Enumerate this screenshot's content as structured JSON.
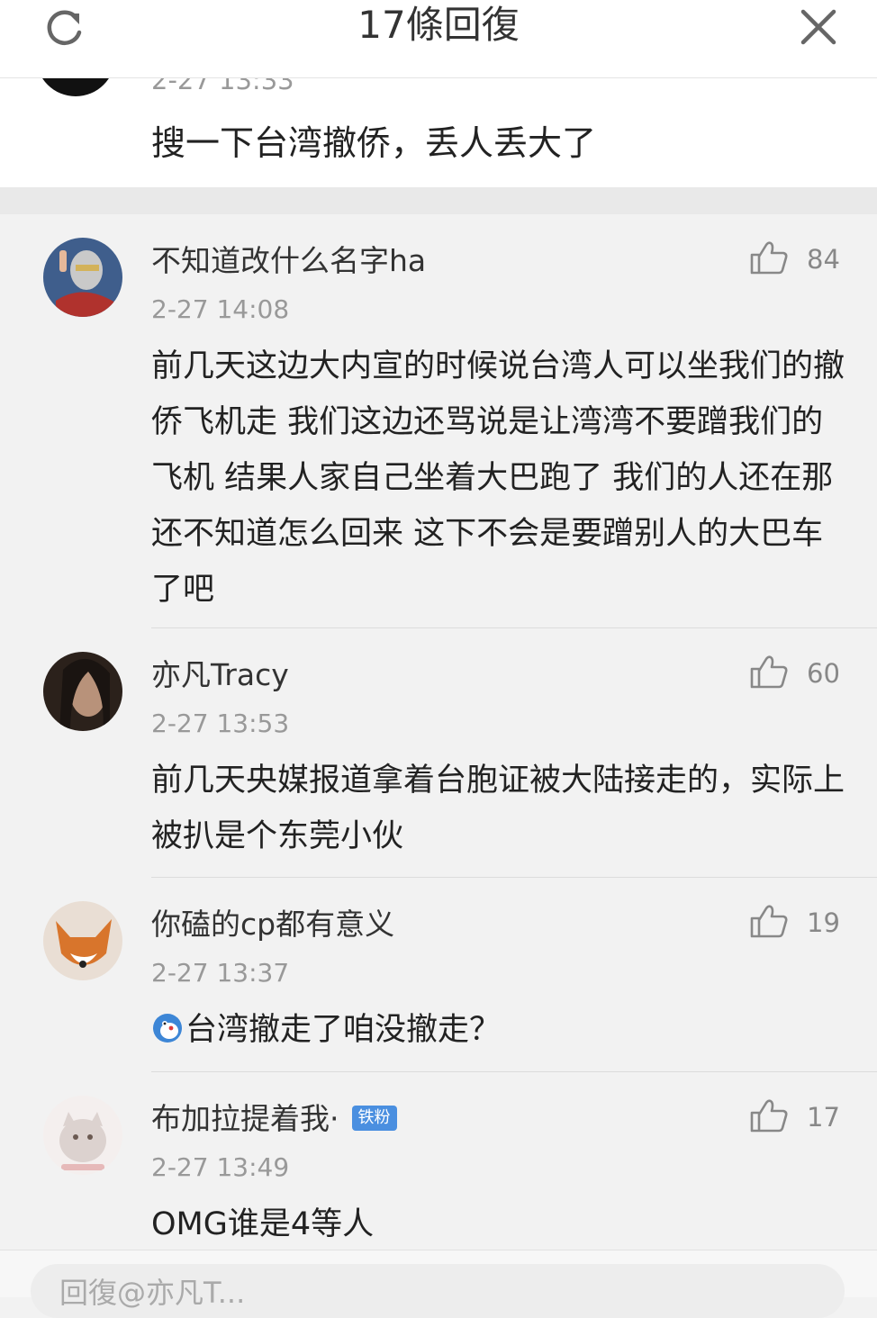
{
  "header": {
    "title": "17條回復",
    "refresh_icon": "refresh-icon",
    "close_icon": "close-icon"
  },
  "previous_comment": {
    "time": "2-27 13:33",
    "text": "搜一下台湾撤侨，丢人丢大了"
  },
  "comments": [
    {
      "name": "不知道改什么名字ha",
      "time": "2-27 14:08",
      "likes": "84",
      "text": "前几天这边大内宣的时候说台湾人可以坐我们的撤侨飞机走 我们这边还骂说是让湾湾不要蹭我们的飞机 结果人家自己坐着大巴跑了 我们的人还在那还不知道怎么回来 这下不会是要蹭别人的大巴车了吧"
    },
    {
      "name": "亦凡Tracy",
      "time": "2-27 13:53",
      "likes": "60",
      "text": "前几天央媒报道拿着台胞证被大陆接走的，实际上被扒是个东莞小伙"
    },
    {
      "name": "你磕的cp都有意义",
      "time": "2-27 13:37",
      "likes": "19",
      "text": "台湾撤走了咱没撤走？",
      "emoji": "doge-emoji"
    },
    {
      "name": "布加拉提着我·",
      "badge": "铁粉",
      "time": "2-27 13:49",
      "likes": "17",
      "text": "OMG谁是4等人"
    }
  ],
  "reply_box": {
    "placeholder": "回復@亦凡T..."
  },
  "colors": {
    "background": "#f2f2f2",
    "card": "#ffffff",
    "badge": "#4a8fe0",
    "secondary_text": "#999999"
  }
}
